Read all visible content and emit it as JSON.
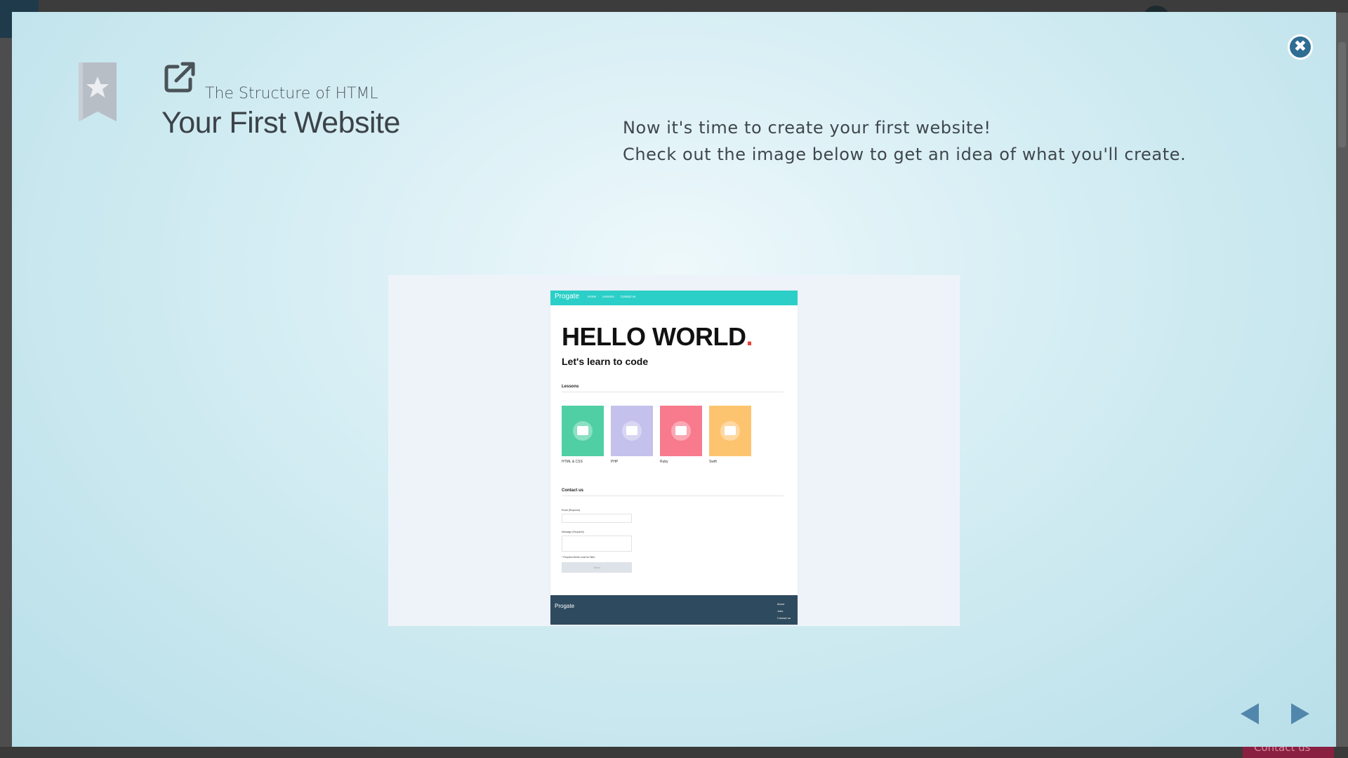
{
  "background": {
    "contact_label": "Contact us"
  },
  "modal": {
    "course_name": "The Structure of HTML",
    "title": "Your First Website",
    "description": [
      "Now it's time to create your first website!",
      "Check out the image below to get an idea of what you'll create."
    ],
    "close_label": "✖",
    "icons": {
      "bookmark": "bookmark-star-icon",
      "external_link": "external-link-icon",
      "close": "close-icon",
      "prev": "triangle-left-icon",
      "next": "triangle-right-icon"
    },
    "colors": {
      "accent": "#2f6d93",
      "arrow": "#5287ad",
      "bookmark": "#b8bec6"
    }
  },
  "preview": {
    "logo": "Progate",
    "nav": [
      "Home",
      "Lessons",
      "Contact us"
    ],
    "headline": "HELLO WORLD",
    "headline_dot": ".",
    "subheadline": "Let's learn to code",
    "lessons_heading": "Lessons",
    "lessons": [
      {
        "label": "HTML & CSS",
        "color": "#4fcfa3"
      },
      {
        "label": "PHP",
        "color": "#c4c1ec"
      },
      {
        "label": "Ruby",
        "color": "#f87a8d"
      },
      {
        "label": "Swift",
        "color": "#fdc470"
      }
    ],
    "contact_heading": "Contact us",
    "email_label": "Email (Required)",
    "message_label": "Message (Required)",
    "required_note": "* Required fields must be filled",
    "send_label": "Send",
    "footer_logo": "Progate",
    "footer_links": [
      "About",
      "Jobs",
      "Contact us"
    ],
    "colors": {
      "header": "#2bcfc7",
      "footer": "#2e4a5e",
      "dot": "#e8453c"
    }
  }
}
